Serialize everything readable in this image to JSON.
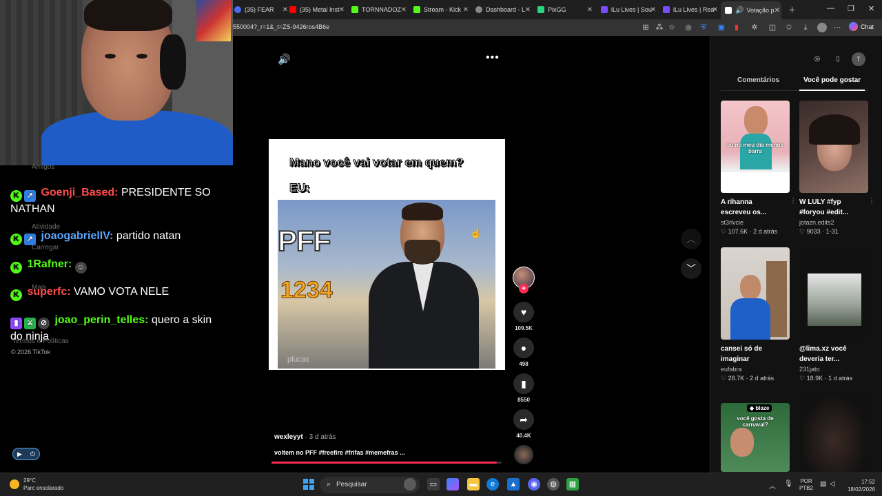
{
  "browser": {
    "tabs": [
      {
        "label": "(35) FEAR",
        "color": "#ff0000"
      },
      {
        "label": "(35) Metal Inst",
        "color": "#ff0000"
      },
      {
        "label": "TORNNADOZ",
        "color": "#53fc18"
      },
      {
        "label": "Stream - Kick",
        "color": "#53fc18"
      },
      {
        "label": "Dashboard - L",
        "color": "#888888"
      },
      {
        "label": "PixGG",
        "color": "#2bd47a"
      },
      {
        "label": "iLu Lives | Sou",
        "color": "#7a4cff"
      },
      {
        "label": "iLu Lives | Rea",
        "color": "#7a4cff"
      },
      {
        "label": "Votação p",
        "color": "#ffffff"
      }
    ],
    "url": "550004?_r=1&_t=ZS-9426ros4B6e",
    "chat_button": "Chat"
  },
  "chat": {
    "ghost_labels": [
      "Amigos",
      "Atividade",
      "Carregar",
      "Mais",
      "Termos e Políticas"
    ],
    "messages": [
      {
        "user": "Goenji_Based:",
        "text": "PRESIDENTE SO NATHAN",
        "color": "#ff4d4d"
      },
      {
        "user": "joaogabrielIV:",
        "text": "partido natan",
        "color": "#5aa6ff"
      },
      {
        "user": "1Rafner:",
        "text": "",
        "color": "#53fc18"
      },
      {
        "user": "superfc:",
        "text": "VAMO VOTA NELE",
        "color": "#ff4d4d"
      },
      {
        "user": "joao_perin_telles:",
        "text": "quero a skin do ninja",
        "color": "#53fc18"
      }
    ],
    "footer": "© 2026 TikTok"
  },
  "video": {
    "meme_top": "Mano você vai votar em quem?",
    "meme_eu": "EU:",
    "pff": "PFF",
    "pff_number": "1234",
    "watermark": "plucas",
    "likes": "109.5K",
    "comments": "498",
    "saves": "8550",
    "shares": "40.4K",
    "author": "wexleyyt",
    "time": " · 3 d atrás",
    "caption": "voltem no PFF #freefire #frifas #memefras  ...",
    "progress": 0.98
  },
  "panel": {
    "avatar_letter": "T",
    "tab_comments": "Comentários",
    "tab_recommend": "Você pode gostar",
    "cards": [
      {
        "title": "A rihanna escreveu os...",
        "user": "st3rlvcie",
        "likes": "107.6K",
        "time": "2 d atrás",
        "overlay": "eu no meu dia menos barra"
      },
      {
        "title": "W LULY #fyp #foryou #edit...",
        "user": "jotazn.edits2",
        "likes": "9033",
        "time": "1-31",
        "overlay": ""
      },
      {
        "title": "cansei só de imaginar",
        "user": "eufabra",
        "likes": "28.7K",
        "time": "2 d atrás",
        "overlay": ""
      },
      {
        "title": "@lima.xz você deveria ter...",
        "user": "231jato",
        "likes": "18.9K",
        "time": "1 d atrás",
        "overlay": ""
      },
      {
        "title": "",
        "user": "",
        "likes": "",
        "time": "",
        "overlay": "você gosta de carnaval?"
      },
      {
        "title": "",
        "user": "",
        "likes": "",
        "time": "",
        "overlay": ""
      }
    ],
    "brand_tag": "blaze"
  },
  "taskbar": {
    "temp": "29°C",
    "weather": "Parc ensolarado",
    "search": "Pesquisar",
    "lang1": "POR",
    "lang2": "PTB2",
    "time": "17:52",
    "date": "18/02/2026"
  }
}
